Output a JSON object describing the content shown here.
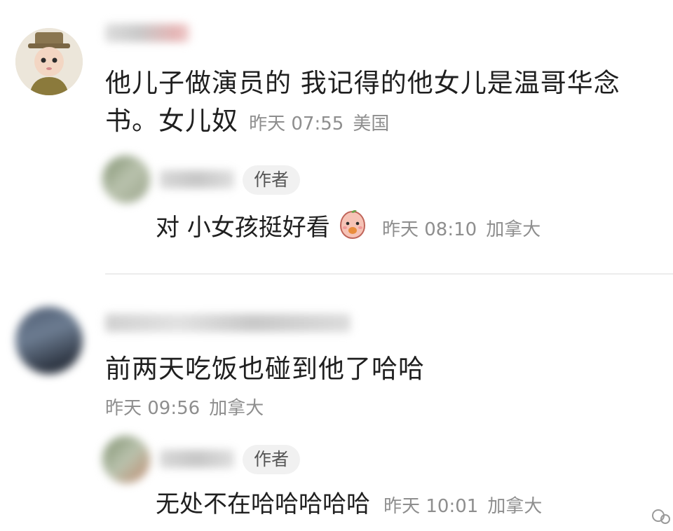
{
  "comments": [
    {
      "text": "他儿子做演员的 我记得的他女儿是温哥华念书。女儿奴",
      "line1": "他儿子做演员的 我记得的他女儿是温哥华念",
      "line2": "书。女儿奴",
      "time": "昨天 07:55",
      "location": "美国",
      "reply": {
        "badge": "作者",
        "text": "对 小女孩挺好看",
        "emoji": "peach-sticker-icon",
        "time": "昨天 08:10",
        "location": "加拿大"
      }
    },
    {
      "text": "前两天吃饭也碰到他了哈哈",
      "time": "昨天 09:56",
      "location": "加拿大",
      "reply": {
        "badge": "作者",
        "text": "无处不在哈哈哈哈哈",
        "time": "昨天 10:01",
        "location": "加拿大"
      }
    }
  ],
  "colors": {
    "meta": "#8e8e8e",
    "badge_bg": "#f1f1f1",
    "divider": "#ececec"
  }
}
